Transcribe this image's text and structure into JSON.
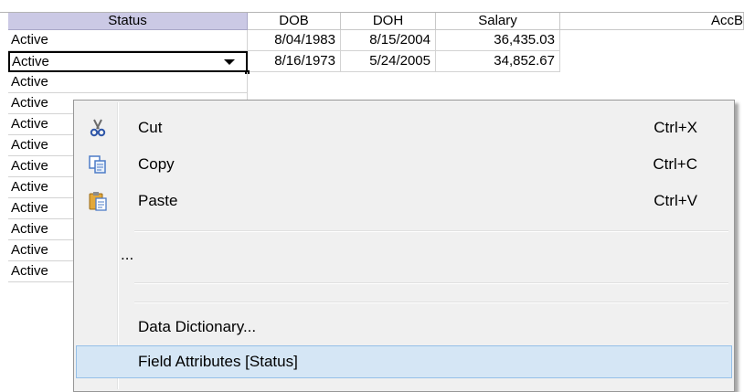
{
  "grid": {
    "headers": [
      "Status",
      "DOB",
      "DOH",
      "Salary",
      "AccB"
    ],
    "rows": [
      [
        "Active",
        "8/04/1983",
        "8/15/2004",
        "36,435.03"
      ],
      [
        "Active",
        "8/16/1973",
        "5/24/2005",
        "34,852.67"
      ],
      [
        "Active"
      ],
      [
        "Active"
      ],
      [
        "Active"
      ],
      [
        "Active"
      ],
      [
        "Active"
      ],
      [
        "Active"
      ],
      [
        "Active"
      ],
      [
        "Active"
      ],
      [
        "Active"
      ],
      [
        "Active"
      ]
    ]
  },
  "menu": {
    "cut": {
      "label": "Cut",
      "shortcut": "Ctrl+X",
      "icon": "scissors-icon"
    },
    "copy": {
      "label": "Copy",
      "shortcut": "Ctrl+C",
      "icon": "copy-icon"
    },
    "paste": {
      "label": "Paste",
      "shortcut": "Ctrl+V",
      "icon": "paste-icon"
    },
    "more": {
      "label": "..."
    },
    "data_dictionary": {
      "label": "Data Dictionary..."
    },
    "field_attributes": {
      "label": "Field Attributes [Status]"
    }
  },
  "colors": {
    "header_selected": "#cbc9e5",
    "menu_highlight": "#d5e6f5"
  }
}
